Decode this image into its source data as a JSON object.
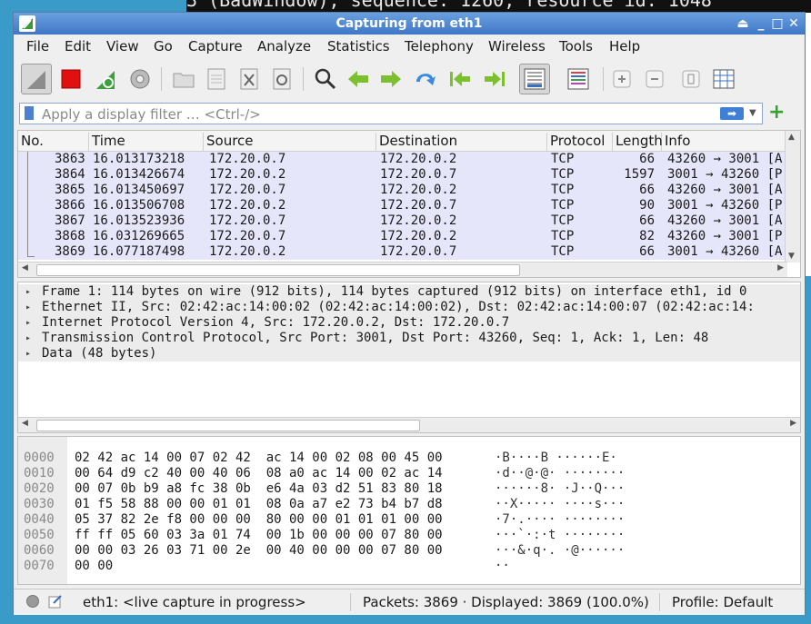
{
  "background_terminal": {
    "text": "3 (BadWindow), sequence: 1260, resource id: 1048"
  },
  "window": {
    "title": "Capturing from eth1"
  },
  "menu": [
    "File",
    "Edit",
    "View",
    "Go",
    "Capture",
    "Analyze",
    "Statistics",
    "Telephony",
    "Wireless",
    "Tools",
    "Help"
  ],
  "toolbar": {
    "icons": [
      "start-capture-icon",
      "stop-capture-icon",
      "restart-capture-icon",
      "capture-options-icon",
      "open-file-icon",
      "save-file-icon",
      "close-file-icon",
      "reload-file-icon",
      "find-packet-icon",
      "go-back-icon",
      "go-forward-icon",
      "go-to-packet-icon",
      "first-packet-icon",
      "last-packet-icon",
      "autoscroll-icon",
      "colorize-icon",
      "zoom-in-icon",
      "zoom-out-icon",
      "normal-size-icon",
      "resize-columns-icon"
    ]
  },
  "filter": {
    "placeholder": "Apply a display filter … <Ctrl-/>"
  },
  "packet_list": {
    "columns": [
      "No.",
      "Time",
      "Source",
      "Destination",
      "Protocol",
      "Length",
      "Info"
    ],
    "rows": [
      {
        "no": "3863",
        "time": "16.013173218",
        "src": "172.20.0.7",
        "dst": "172.20.0.2",
        "proto": "TCP",
        "len": "66",
        "info": "43260 → 3001 [A"
      },
      {
        "no": "3864",
        "time": "16.013426674",
        "src": "172.20.0.2",
        "dst": "172.20.0.7",
        "proto": "TCP",
        "len": "1597",
        "info": "3001 → 43260 [P"
      },
      {
        "no": "3865",
        "time": "16.013450697",
        "src": "172.20.0.7",
        "dst": "172.20.0.2",
        "proto": "TCP",
        "len": "66",
        "info": "43260 → 3001 [A"
      },
      {
        "no": "3866",
        "time": "16.013506708",
        "src": "172.20.0.2",
        "dst": "172.20.0.7",
        "proto": "TCP",
        "len": "90",
        "info": "3001 → 43260 [P"
      },
      {
        "no": "3867",
        "time": "16.013523936",
        "src": "172.20.0.7",
        "dst": "172.20.0.2",
        "proto": "TCP",
        "len": "66",
        "info": "43260 → 3001 [A"
      },
      {
        "no": "3868",
        "time": "16.031269665",
        "src": "172.20.0.7",
        "dst": "172.20.0.2",
        "proto": "TCP",
        "len": "82",
        "info": "43260 → 3001 [P"
      },
      {
        "no": "3869",
        "time": "16.077187498",
        "src": "172.20.0.2",
        "dst": "172.20.0.7",
        "proto": "TCP",
        "len": "66",
        "info": "3001 → 43260 [A"
      }
    ]
  },
  "details": [
    "Frame 1: 114 bytes on wire (912 bits), 114 bytes captured (912 bits) on interface eth1, id 0",
    "Ethernet II, Src: 02:42:ac:14:00:02 (02:42:ac:14:00:02), Dst: 02:42:ac:14:00:07 (02:42:ac:14:",
    "Internet Protocol Version 4, Src: 172.20.0.2, Dst: 172.20.0.7",
    "Transmission Control Protocol, Src Port: 3001, Dst Port: 43260, Seq: 1, Ack: 1, Len: 48",
    "Data (48 bytes)"
  ],
  "bytes": [
    {
      "off": "0000",
      "hex": "02 42 ac 14 00 07 02 42  ac 14 00 02 08 00 45 00",
      "ascii": "·B····B ······E·"
    },
    {
      "off": "0010",
      "hex": "00 64 d9 c2 40 00 40 06  08 a0 ac 14 00 02 ac 14",
      "ascii": "·d··@·@· ········"
    },
    {
      "off": "0020",
      "hex": "00 07 0b b9 a8 fc 38 0b  e6 4a 03 d2 51 83 80 18",
      "ascii": "······8· ·J··Q···"
    },
    {
      "off": "0030",
      "hex": "01 f5 58 88 00 00 01 01  08 0a a7 e2 73 b4 b7 d8",
      "ascii": "··X····· ····s···"
    },
    {
      "off": "0040",
      "hex": "05 37 82 2e f8 00 00 00  80 00 00 01 01 01 00 00",
      "ascii": "·7·.···· ········"
    },
    {
      "off": "0050",
      "hex": "ff ff 05 60 03 3a 01 74  00 1b 00 00 00 07 80 00",
      "ascii": "···`·:·t ········"
    },
    {
      "off": "0060",
      "hex": "00 00 03 26 03 71 00 2e  00 40 00 00 00 07 80 00",
      "ascii": "···&·q·. ·@······"
    },
    {
      "off": "0070",
      "hex": "00 00",
      "ascii": "··"
    }
  ],
  "status": {
    "capture": "eth1: <live capture in progress>",
    "packets": "Packets: 3869 · Displayed: 3869 (100.0%)",
    "profile": "Profile: Default"
  },
  "colors": {
    "title_bar": "#3f77c6",
    "row_highlight": "#e6e6fb",
    "accent_blue": "#4f7fd0"
  }
}
